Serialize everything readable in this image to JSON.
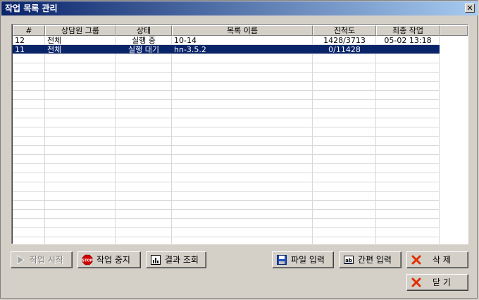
{
  "window": {
    "title": "작업 목록 관리",
    "close_glyph": "✕"
  },
  "table": {
    "columns": [
      "#",
      "상담원 그룹",
      "상태",
      "목록 이름",
      "진척도",
      "최종 작업"
    ],
    "rows": [
      {
        "num": "12",
        "group": "전체",
        "status": "실행 중",
        "name": "10-14",
        "progress": "1428/3713",
        "last": "05-02 13:18",
        "selected": false
      },
      {
        "num": "11",
        "group": "전체",
        "status": "실행 대기",
        "name": "hn-3.5.2",
        "progress": "0/11428",
        "last": "",
        "selected": true
      }
    ]
  },
  "buttons": {
    "start": "작업 시작",
    "stop": "작업 중지",
    "results": "결과 조회",
    "file_input": "파일 입력",
    "quick_input": "간편 입력",
    "delete": "삭 제",
    "close": "닫 기"
  },
  "colors": {
    "selection": "#0a246a",
    "title_start": "#0a246a",
    "title_end": "#a6caf0",
    "face": "#d4d0c8"
  }
}
